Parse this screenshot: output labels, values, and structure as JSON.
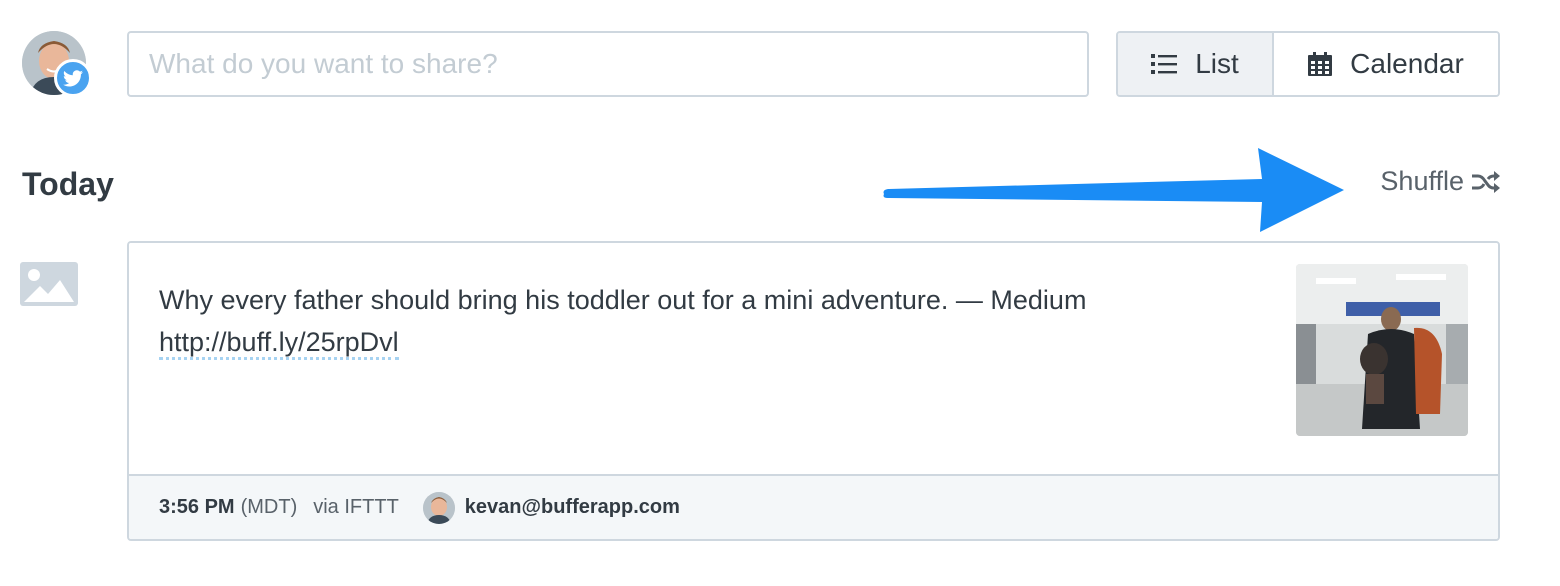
{
  "composer": {
    "placeholder": "What do you want to share?",
    "avatar_icon": "user-avatar",
    "network_icon": "twitter-icon",
    "network_color": "#4aa3f0"
  },
  "view_toggle": {
    "list_label": "List",
    "list_icon": "list-icon",
    "calendar_label": "Calendar",
    "calendar_icon": "calendar-icon",
    "active": "List"
  },
  "section": {
    "title": "Today",
    "shuffle_label": "Shuffle",
    "shuffle_icon": "shuffle-icon",
    "annotation_icon": "arrow-icon",
    "annotation_color": "#1a8cf5"
  },
  "post": {
    "media_icon": "image-icon",
    "text": "Why every father should bring his toddler out for a mini adventure. — Medium",
    "link": "http://buff.ly/25rpDvl",
    "footer": {
      "time": "3:56 PM",
      "timezone": "(MDT)",
      "via": "via IFTTT",
      "user": "kevan@bufferapp.com"
    }
  }
}
